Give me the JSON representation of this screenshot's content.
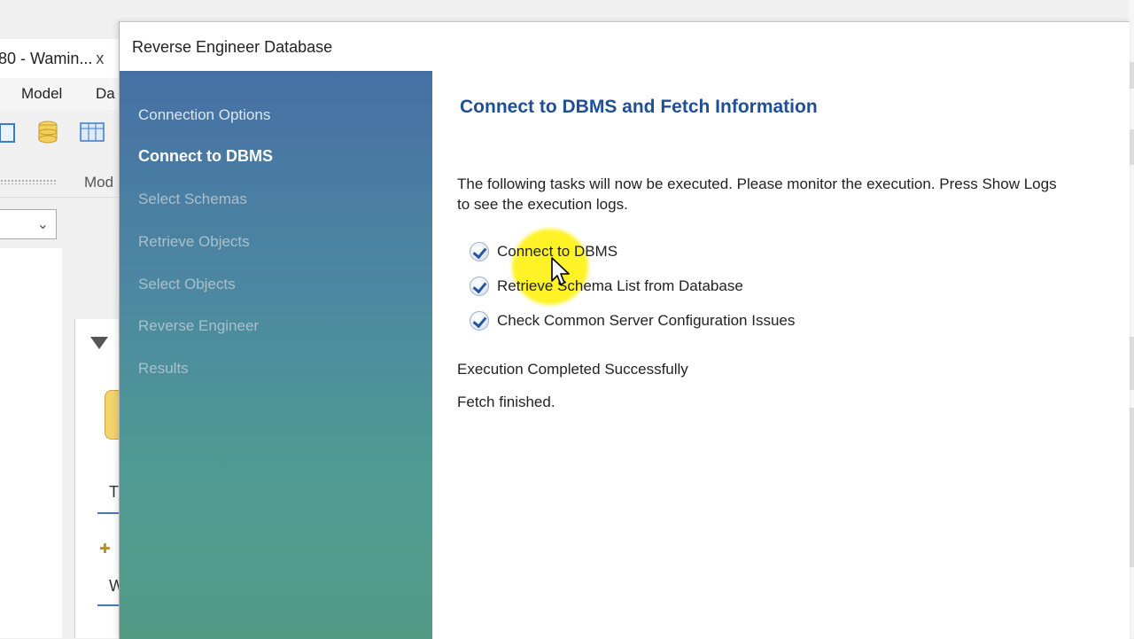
{
  "background": {
    "tab_title": "80 - Wamin...",
    "tab_close": "x",
    "menu": [
      "Model",
      "Da"
    ],
    "panel_label": "Mod",
    "letters": [
      "T",
      "W"
    ]
  },
  "dialog": {
    "title": "Reverse Engineer Database",
    "steps": [
      {
        "label": "Connection Options",
        "state": "done"
      },
      {
        "label": "Connect to DBMS",
        "state": "active"
      },
      {
        "label": "Select Schemas",
        "state": "pending"
      },
      {
        "label": "Retrieve Objects",
        "state": "pending"
      },
      {
        "label": "Select Objects",
        "state": "pending"
      },
      {
        "label": "Reverse Engineer",
        "state": "pending"
      },
      {
        "label": "Results",
        "state": "pending"
      }
    ],
    "heading": "Connect to DBMS and Fetch Information",
    "description": "The following tasks will now be executed. Please monitor the execution. Press Show Logs to see the execution logs.",
    "tasks": [
      {
        "label": "Connect to DBMS",
        "checked": true
      },
      {
        "label": "Retrieve Schema List from Database",
        "checked": true
      },
      {
        "label": "Check Common Server Configuration Issues",
        "checked": true
      }
    ],
    "status_text": "Execution Completed Successfully",
    "fetch_text": "Fetch finished."
  },
  "colors": {
    "heading": "#1f4f96",
    "sidebar_top": "#4670a4",
    "sidebar_bottom": "#539a85",
    "cursor_highlight": "#fff000"
  },
  "icons": [
    "check-circle-icon",
    "mouse-pointer-icon",
    "database-icon",
    "chevron-down-icon",
    "collapse-triangle-icon"
  ]
}
